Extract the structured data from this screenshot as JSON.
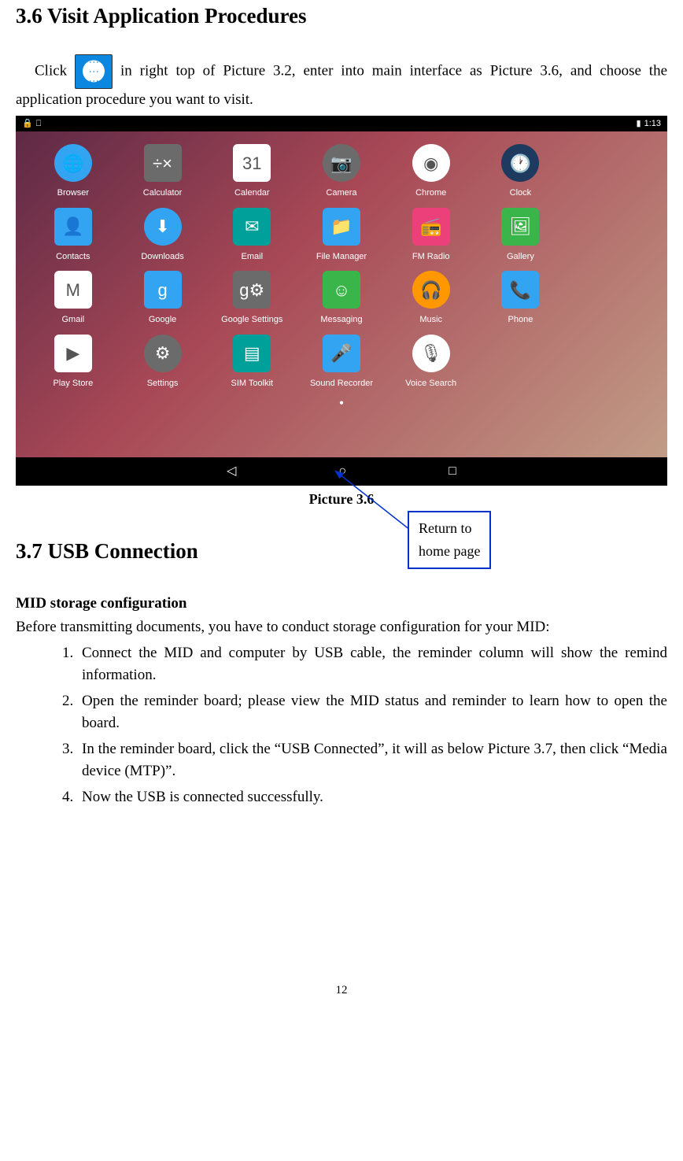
{
  "section1": {
    "title": "3.6 Visit Application Procedures",
    "intro_before": "Click",
    "intro_after": " in right top of Picture 3.2, enter into main interface as Picture 3.6, and choose the application procedure you want to visit."
  },
  "screenshot": {
    "status_time": "1:13",
    "apps": [
      {
        "label": "Browser",
        "glyph": "🌐",
        "cls": "b-blue round"
      },
      {
        "label": "Calculator",
        "glyph": "÷×",
        "cls": "b-gray"
      },
      {
        "label": "Calendar",
        "glyph": "31",
        "cls": "b-white"
      },
      {
        "label": "Camera",
        "glyph": "📷",
        "cls": "b-gray round"
      },
      {
        "label": "Chrome",
        "glyph": "◉",
        "cls": "b-white round"
      },
      {
        "label": "Clock",
        "glyph": "🕐",
        "cls": "b-navy round"
      },
      {
        "label": "",
        "glyph": "",
        "cls": ""
      },
      {
        "label": "Contacts",
        "glyph": "👤",
        "cls": "b-blue"
      },
      {
        "label": "Downloads",
        "glyph": "⬇",
        "cls": "b-blue round"
      },
      {
        "label": "Email",
        "glyph": "✉",
        "cls": "b-teal"
      },
      {
        "label": "File Manager",
        "glyph": "📁",
        "cls": "b-blue"
      },
      {
        "label": "FM Radio",
        "glyph": "📻",
        "cls": "b-pink"
      },
      {
        "label": "Gallery",
        "glyph": "🖼",
        "cls": "b-green"
      },
      {
        "label": "",
        "glyph": "",
        "cls": ""
      },
      {
        "label": "Gmail",
        "glyph": "M",
        "cls": "b-white"
      },
      {
        "label": "Google",
        "glyph": "g",
        "cls": "b-blue"
      },
      {
        "label": "Google Settings",
        "glyph": "g⚙",
        "cls": "b-gray"
      },
      {
        "label": "Messaging",
        "glyph": "☺",
        "cls": "b-green"
      },
      {
        "label": "Music",
        "glyph": "🎧",
        "cls": "b-orange round"
      },
      {
        "label": "Phone",
        "glyph": "📞",
        "cls": "b-blue"
      },
      {
        "label": "",
        "glyph": "",
        "cls": ""
      },
      {
        "label": "Play Store",
        "glyph": "▶",
        "cls": "b-white"
      },
      {
        "label": "Settings",
        "glyph": "⚙",
        "cls": "b-gray round"
      },
      {
        "label": "SIM Toolkit",
        "glyph": "▤",
        "cls": "b-teal"
      },
      {
        "label": "Sound Recorder",
        "glyph": "🎤",
        "cls": "b-blue"
      },
      {
        "label": "Voice Search",
        "glyph": "🎙",
        "cls": "b-white round"
      }
    ],
    "nav": {
      "back": "◁",
      "home": "○",
      "recent": "□"
    },
    "caption": "Picture 3.6",
    "callout_line1": "Return to",
    "callout_line2": "home page"
  },
  "section2": {
    "title": "3.7 USB Connection",
    "subheading": "MID storage configuration",
    "intro": "Before transmitting documents, you have to conduct storage configuration for your MID:",
    "items": [
      "Connect the MID and computer by USB cable, the reminder column will show the remind information.",
      "Open the reminder board; please view the MID status and reminder to learn how to open the board.",
      "In the reminder board, click the “USB Connected”, it will as below Picture 3.7, then click “Media device (MTP)”.",
      "Now the USB is connected successfully."
    ]
  },
  "page_number": "12"
}
